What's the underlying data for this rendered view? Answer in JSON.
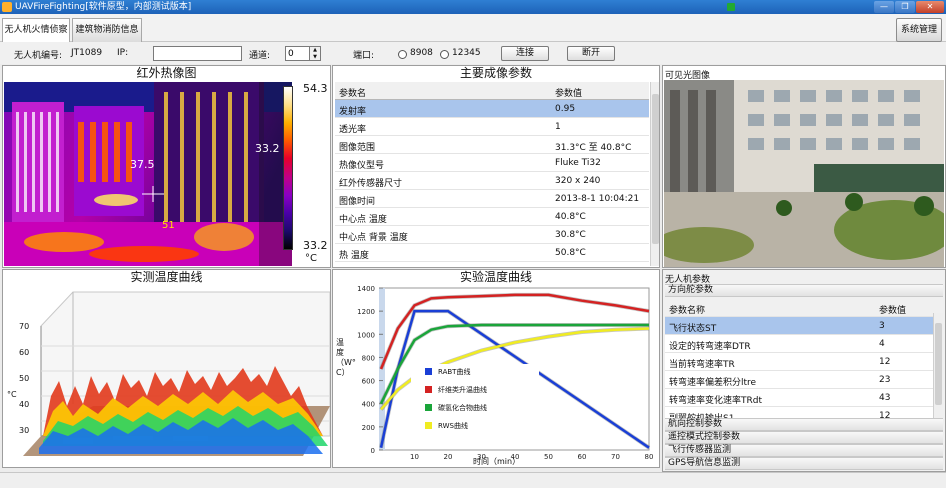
{
  "window": {
    "title": "UAVFireFighting[软件原型，内部测试版本]",
    "min_label": "—",
    "max_label": "❐",
    "close_label": "✕"
  },
  "tabs": [
    {
      "label": "无人机火情侦察"
    },
    {
      "label": "建筑物消防信息"
    }
  ],
  "system_button": "系统管理",
  "controls": {
    "uav_id_label": "无人机编号:",
    "uav_id_value": "JT1089",
    "ip_label": "IP:",
    "ip_value": "",
    "channel_label": "通道:",
    "channel_value": "0",
    "port_label": "端口:",
    "port_options": [
      "8908",
      "12345"
    ],
    "connect_label": "连接",
    "disconnect_label": "断开"
  },
  "infrared": {
    "title": "红外热像图",
    "scale_max": "54.3",
    "scale_min": "33.2",
    "scale_unit": "°C",
    "spot_a": "37.5",
    "spot_b": "33.2",
    "spot_c": "51",
    "palette": [
      "#ffffff",
      "#ffe08a",
      "#ffb000",
      "#ff5a00",
      "#e8002a",
      "#c0008a",
      "#8a00c4",
      "#4a00a8",
      "#1a0a6a",
      "#000000"
    ]
  },
  "params": {
    "title": "主要成像参数",
    "col_name": "参数名",
    "col_value": "参数值",
    "rows": [
      {
        "name": "发射率",
        "value": "0.95"
      },
      {
        "name": "透光率",
        "value": "1"
      },
      {
        "name": "图像范围",
        "value": "31.3°C 至 40.8°C"
      },
      {
        "name": "热像仪型号",
        "value": "Fluke Ti32"
      },
      {
        "name": "红外传感器尺寸",
        "value": "320 x 240"
      },
      {
        "name": "图像时间",
        "value": "2013-8-1 10:04:21"
      },
      {
        "name": "中心点 温度",
        "value": "40.8°C"
      },
      {
        "name": "中心点 背景 温度",
        "value": "30.8°C"
      },
      {
        "name": "热 温度",
        "value": "50.8°C"
      }
    ]
  },
  "visible_image": {
    "title": "可见光图像"
  },
  "measured": {
    "title": "实测温度曲线",
    "y_unit": "°C",
    "y_ticks": [
      "70",
      "60",
      "50",
      "40",
      "30"
    ]
  },
  "experimental": {
    "title": "实验温度曲线"
  },
  "uav_params": {
    "title": "无人机参数",
    "sections_top": [
      "方向舵参数"
    ],
    "col_name": "参数名称",
    "col_value": "参数值",
    "rows": [
      {
        "name": "飞行状态ST",
        "value": "3"
      },
      {
        "name": "设定的转弯速率DTR",
        "value": "4"
      },
      {
        "name": "当前转弯速率TR",
        "value": "12"
      },
      {
        "name": "转弯速率偏差积分ltre",
        "value": "23"
      },
      {
        "name": "转弯速率变化速率TRdt",
        "value": "43"
      },
      {
        "name": "副翼舵机输出S1",
        "value": "12"
      }
    ],
    "sections_bottom": [
      "航向控制参数",
      "遥控模式控制参数",
      "飞行传感器监测",
      "GPS导航信息监测"
    ]
  },
  "chart_data": {
    "type": "line",
    "title": "实验温度曲线",
    "xlabel": "时间（min）",
    "ylabel": "温度（W°C）",
    "xlim": [
      0,
      80
    ],
    "ylim": [
      0,
      1400
    ],
    "x_ticks": [
      10,
      20,
      30,
      40,
      50,
      60,
      70,
      80
    ],
    "y_ticks": [
      0,
      200,
      400,
      600,
      800,
      1000,
      1200,
      1400
    ],
    "grid": false,
    "legend_position": "inside-left",
    "series": [
      {
        "name": "RABT曲线",
        "color": "#1a3fd6",
        "x": [
          0,
          5,
          10,
          15,
          20,
          80
        ],
        "y": [
          20,
          700,
          1200,
          1200,
          1200,
          20
        ]
      },
      {
        "name": "纤维类升温曲线",
        "color": "#d42222",
        "x": [
          0,
          5,
          10,
          15,
          20,
          30,
          40,
          50,
          60,
          70,
          80
        ],
        "y": [
          700,
          1050,
          1250,
          1310,
          1320,
          1330,
          1340,
          1340,
          1290,
          1250,
          1200
        ]
      },
      {
        "name": "碳氢化合物曲线",
        "color": "#1aa53a",
        "x": [
          0,
          5,
          10,
          15,
          20,
          30,
          40,
          50,
          60,
          70,
          80
        ],
        "y": [
          400,
          700,
          950,
          1040,
          1070,
          1080,
          1080,
          1080,
          1080,
          1080,
          1080
        ]
      },
      {
        "name": "RWS曲线",
        "color": "#f0ec22",
        "x": [
          0,
          5,
          10,
          20,
          30,
          40,
          50,
          60,
          70,
          80
        ],
        "y": [
          350,
          520,
          630,
          760,
          860,
          930,
          980,
          1020,
          1040,
          1050
        ]
      }
    ]
  }
}
